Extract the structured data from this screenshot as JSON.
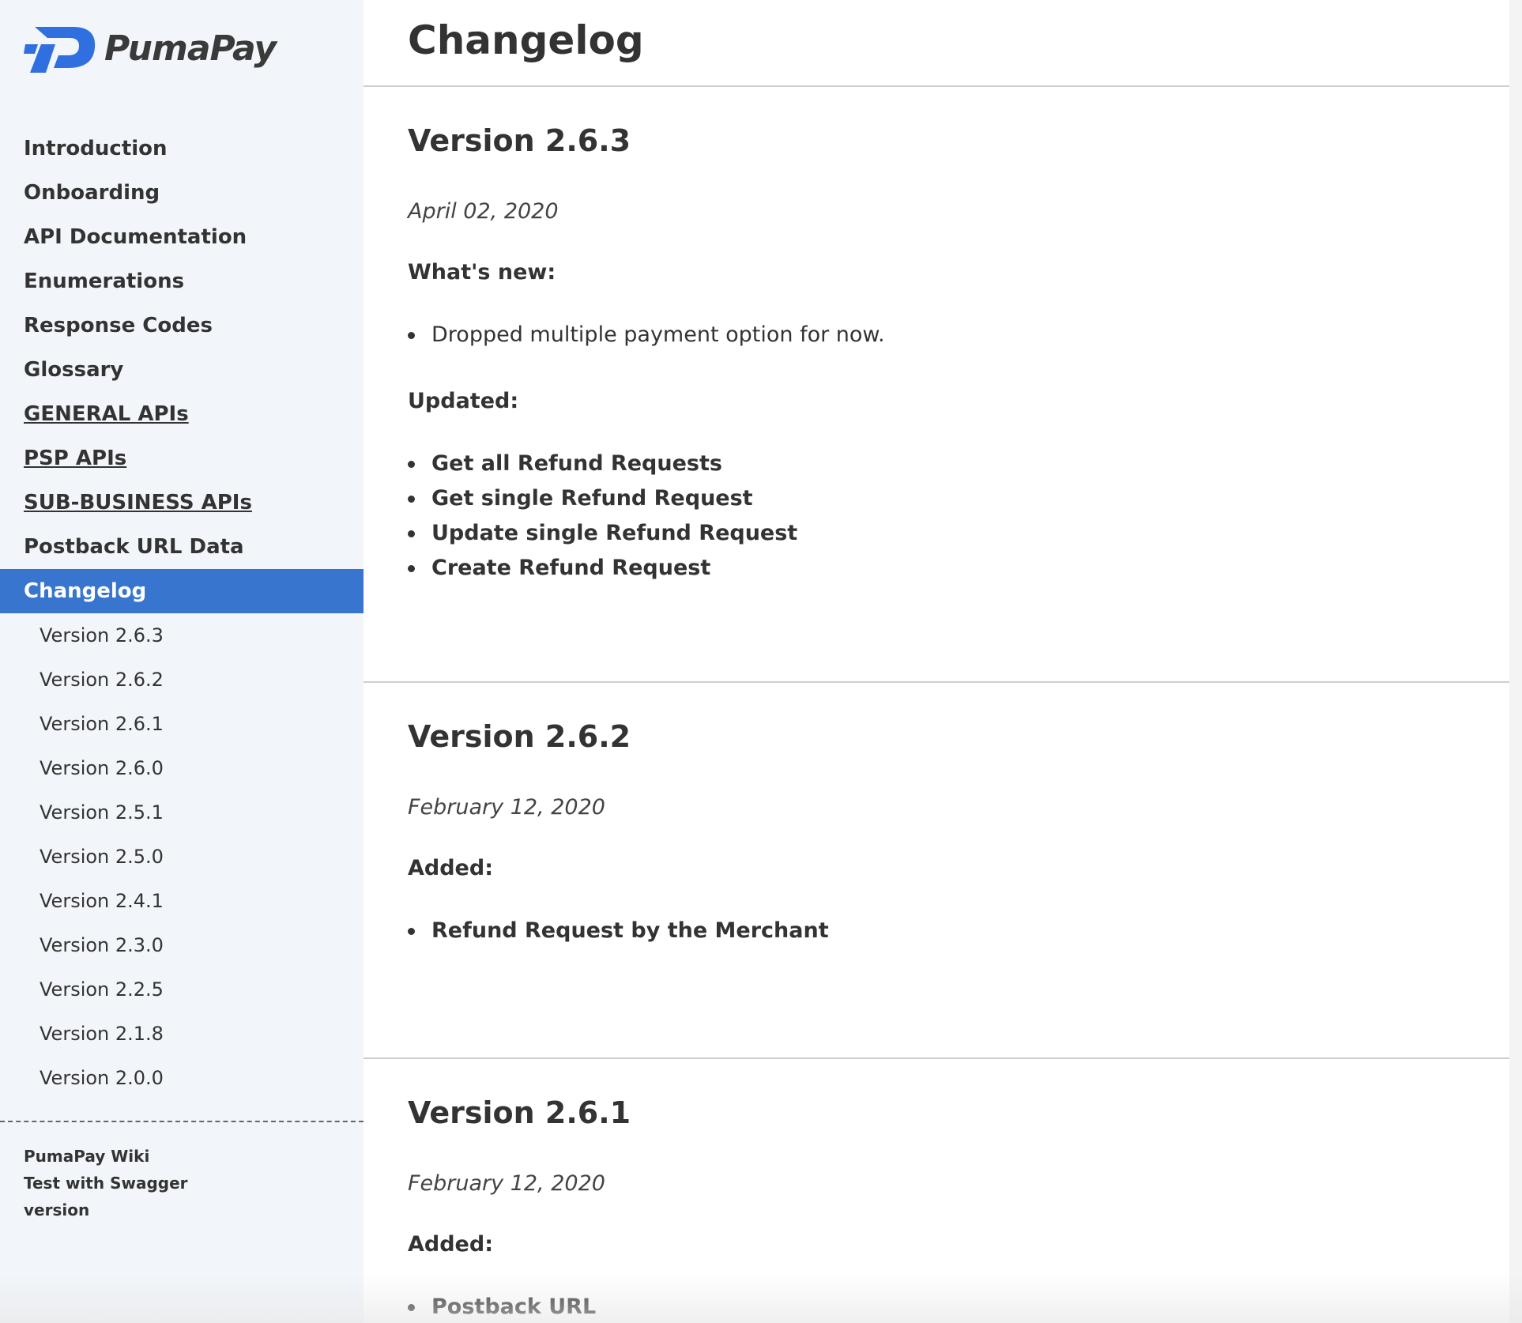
{
  "brand": {
    "name": "PumaPay",
    "logo_color": "#2f6fe0"
  },
  "sidebar": {
    "items": [
      {
        "label": "Introduction"
      },
      {
        "label": "Onboarding"
      },
      {
        "label": "API Documentation"
      },
      {
        "label": "Enumerations"
      },
      {
        "label": "Response Codes"
      },
      {
        "label": "Glossary"
      },
      {
        "label": "GENERAL APIs"
      },
      {
        "label": "PSP APIs"
      },
      {
        "label": "SUB-BUSINESS APIs"
      },
      {
        "label": "Postback URL Data"
      },
      {
        "label": "Changelog"
      }
    ],
    "active_item": "Changelog",
    "active_color": "#3775cf",
    "subitems": [
      "Version 2.6.3",
      "Version 2.6.2",
      "Version 2.6.1",
      "Version 2.6.0",
      "Version 2.5.1",
      "Version 2.5.0",
      "Version 2.4.1",
      "Version 2.3.0",
      "Version 2.2.5",
      "Version 2.1.8",
      "Version 2.0.0"
    ],
    "footer": [
      "PumaPay Wiki",
      "Test with Swagger",
      "version"
    ]
  },
  "main": {
    "title": "Changelog",
    "versions": [
      {
        "title": "Version 2.6.3",
        "date": "April 02, 2020",
        "groups": [
          {
            "heading": "What's new:",
            "items": [
              "Dropped multiple payment option for now."
            ]
          },
          {
            "heading": "Updated:",
            "items": [
              "Get all Refund Requests",
              "Get single Refund Request",
              "Update single Refund Request",
              "Create Refund Request"
            ]
          }
        ]
      },
      {
        "title": "Version 2.6.2",
        "date": "February 12, 2020",
        "groups": [
          {
            "heading": "Added:",
            "items": [
              "Refund Request by the Merchant"
            ]
          }
        ]
      },
      {
        "title": "Version 2.6.1",
        "date": "February 12, 2020",
        "groups": [
          {
            "heading": "Added:",
            "items": [
              "Postback URL"
            ]
          }
        ]
      }
    ]
  }
}
